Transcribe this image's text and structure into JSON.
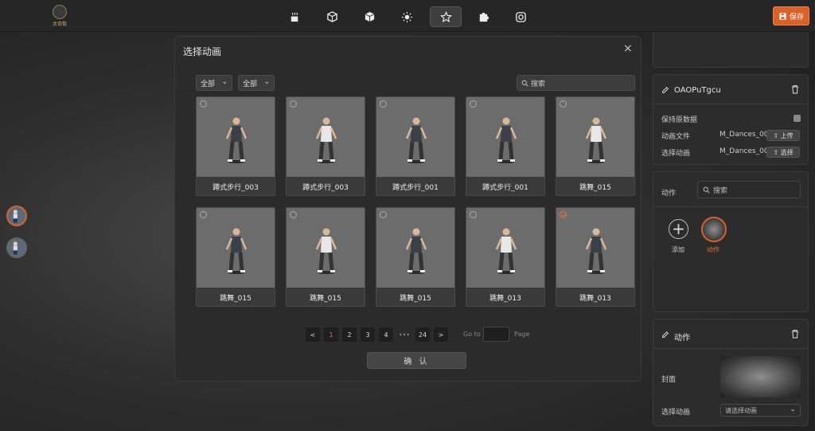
{
  "app": {
    "logo_text": "太奇数"
  },
  "toolbar": {
    "tools": [
      "coffee-icon",
      "box-icon",
      "cube-icon",
      "sun-icon",
      "star-icon",
      "puzzle-icon",
      "camera-icon"
    ],
    "active_tool": "star-icon",
    "save_label": "保存"
  },
  "modal": {
    "title": "选择动画",
    "close": "×",
    "filter1": "全部",
    "filter2": "全部",
    "search_placeholder": "搜索",
    "cards": [
      {
        "label": "蹲式步行_003",
        "checked": false
      },
      {
        "label": "蹲式步行_003",
        "checked": false
      },
      {
        "label": "蹲式步行_001",
        "checked": false
      },
      {
        "label": "蹲式步行_001",
        "checked": false
      },
      {
        "label": "跳舞_015",
        "checked": false
      },
      {
        "label": "跳舞_015",
        "checked": false
      },
      {
        "label": "跳舞_015",
        "checked": false
      },
      {
        "label": "跳舞_015",
        "checked": false
      },
      {
        "label": "跳舞_013",
        "checked": false
      },
      {
        "label": "跳舞_013",
        "checked": true
      }
    ],
    "pagination": {
      "prev": "<",
      "next": ">",
      "pages": [
        "1",
        "2",
        "3",
        "4"
      ],
      "ellipsis": "•••",
      "last": "24",
      "current": "1",
      "goto_label": "Go to",
      "page_label": "Page"
    },
    "confirm_label": "确 认"
  },
  "right_panel": {
    "object": {
      "name": "OAOPuTgcu",
      "keep_original_label": "保持原数据",
      "anim_file_label": "动画文件",
      "anim_file_value": "M_Dances_00",
      "upload_label": "上传",
      "select_anim_label": "选择动画",
      "select_anim_value": "M_Dances_00",
      "select_label": "选择"
    },
    "actions": {
      "label": "动作",
      "search_placeholder": "搜索",
      "add_label": "添加",
      "item_label": "动作"
    },
    "action_detail": {
      "title": "动作",
      "cover_label": "封面",
      "select_anim_label": "选择动画",
      "select_placeholder": "请选择动画"
    }
  }
}
